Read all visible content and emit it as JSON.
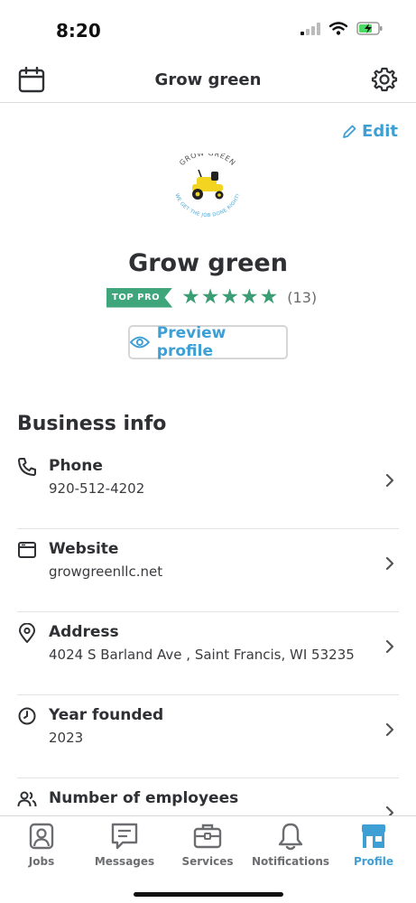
{
  "status_bar": {
    "time": "8:20"
  },
  "header": {
    "title": "Grow green"
  },
  "profile": {
    "edit_label": "Edit",
    "logo_text_top": "GROW GREEN",
    "logo_text_bottom": "WE GET THE JOB DONE RIGHT!",
    "business_name": "Grow green",
    "badge": "TOP PRO",
    "rating_stars": 5,
    "review_count": "(13)",
    "preview_label": "Preview profile"
  },
  "business_info": {
    "title": "Business info",
    "items": [
      {
        "icon": "phone-icon",
        "label": "Phone",
        "value": "920-512-4202"
      },
      {
        "icon": "website-icon",
        "label": "Website",
        "value": "growgreenllc.net"
      },
      {
        "icon": "location-pin-icon",
        "label": "Address",
        "value": "4024 S Barland Ave , Saint Francis, WI 53235"
      },
      {
        "icon": "clock-icon",
        "label": "Year founded",
        "value": "2023"
      },
      {
        "icon": "people-icon",
        "label": "Number of employees",
        "value": ""
      }
    ]
  },
  "tab_bar": {
    "tabs": [
      {
        "label": "Jobs",
        "icon": "jobs-icon"
      },
      {
        "label": "Messages",
        "icon": "messages-icon"
      },
      {
        "label": "Services",
        "icon": "briefcase-icon"
      },
      {
        "label": "Notifications",
        "icon": "bell-icon"
      },
      {
        "label": "Profile",
        "icon": "storefront-icon",
        "active": true
      }
    ]
  },
  "colors": {
    "accent": "#3d9fd4",
    "brand_green": "#3a9d74",
    "text": "#2f3033"
  }
}
